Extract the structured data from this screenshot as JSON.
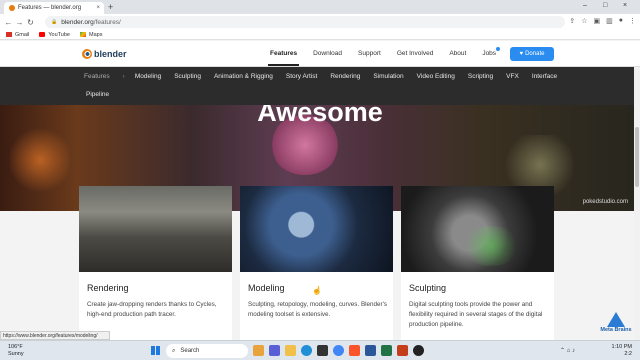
{
  "browser": {
    "tab_title": "Features — blender.org",
    "tab_close": "×",
    "new_tab": "+",
    "url_domain": "blender.org",
    "url_path": "/features/",
    "bookmarks": [
      "Gmail",
      "YouTube",
      "Maps"
    ],
    "window_controls": [
      "–",
      "□",
      "×"
    ]
  },
  "site": {
    "logo_text": "blender",
    "nav": [
      "Features",
      "Download",
      "Support",
      "Get Involved",
      "About",
      "Jobs",
      "Store"
    ],
    "donate_label": "Donate",
    "subnav_row1": [
      "Modeling",
      "Sculpting",
      "Animation & Rigging",
      "Story Artist",
      "Rendering",
      "Simulation",
      "Video Editing",
      "Scripting",
      "VFX",
      "Interface"
    ],
    "subnav_home": "Features",
    "subnav_row2": [
      "Pipeline"
    ],
    "hero_title": "Awesome",
    "hero_credit": "pokedstudio.com"
  },
  "cards": [
    {
      "title": "Rendering",
      "text": "Create jaw-dropping renders thanks to Cycles, high-end production path tracer."
    },
    {
      "title": "Modeling",
      "text": "Sculpting, retopology, modeling, curves. Blender's modeling toolset is extensive."
    },
    {
      "title": "Sculpting",
      "text": "Digital sculpting tools provide the power and flexibility required in several stages of the digital production pipeline."
    }
  ],
  "status_url": "https://www.blender.org/features/modeling/",
  "watermark": "Meta Brains",
  "taskbar": {
    "temperature": "106°F",
    "weather": "Sunny",
    "search_label": "Search",
    "time": "1:10 PM",
    "date": "2:2"
  },
  "colors": {
    "accent": "#2b8cf0",
    "blender_orange": "#e87d0d",
    "subnav_bg": "#2c2c2c"
  }
}
